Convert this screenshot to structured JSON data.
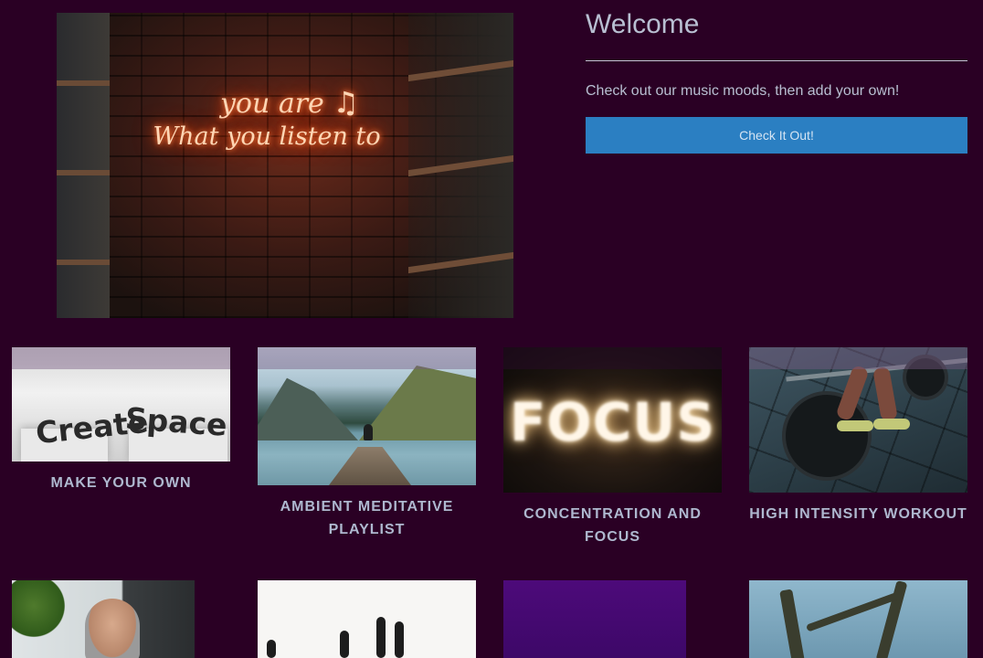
{
  "hero": {
    "image_alt": "neon sign on a brick wall",
    "neon_line1": "you are",
    "neon_line2": "What you listen to"
  },
  "welcome": {
    "title": "Welcome",
    "description": "Check out our music moods, then add your own!",
    "button_label": "Check It Out!"
  },
  "playlists": [
    {
      "title": "MAKE YOUR OWN",
      "image_text_1": "Create",
      "image_text_2": "Space"
    },
    {
      "title": "AMBIENT MEDITATIVE PLAYLIST"
    },
    {
      "title": "CONCENTRATION AND FOCUS",
      "image_text": "FOCUS"
    },
    {
      "title": "HIGH INTENSITY WORKOUT"
    }
  ],
  "colors": {
    "background": "#2a0024",
    "accent_button": "#2b7fc2",
    "text": "#b8bfd2"
  }
}
